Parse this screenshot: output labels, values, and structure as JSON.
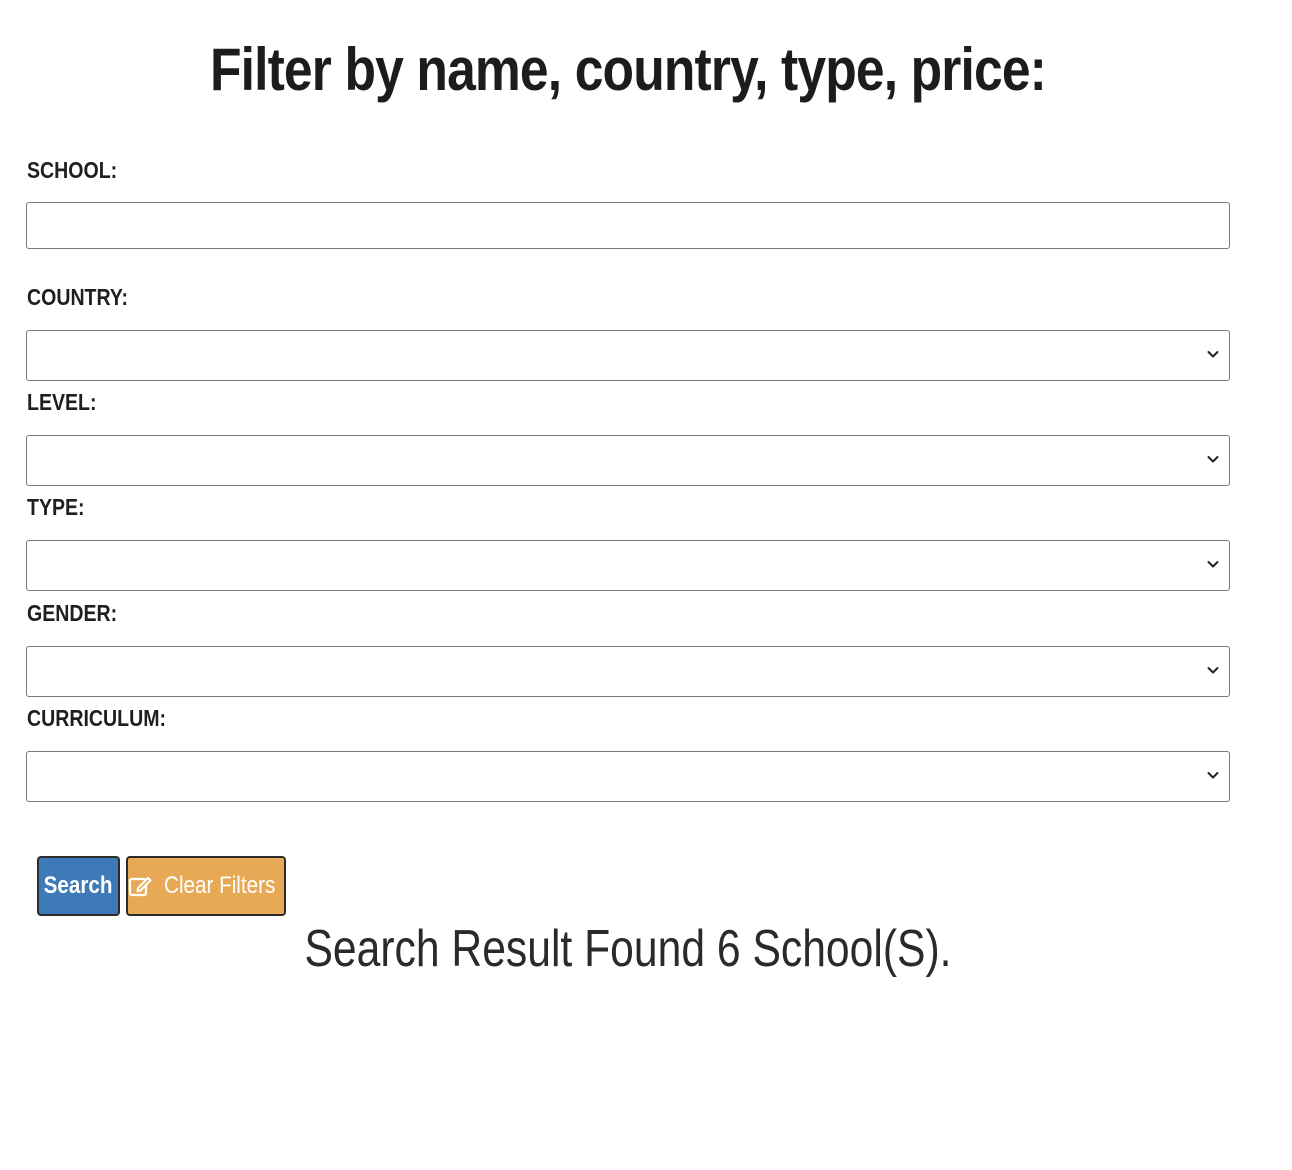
{
  "header": {
    "title": "Filter by name, country, type, price:"
  },
  "form": {
    "school": {
      "label": "SCHOOL:",
      "value": "",
      "placeholder": ""
    },
    "country": {
      "label": "COUNTRY:",
      "selected": ""
    },
    "level": {
      "label": "LEVEL:",
      "selected": ""
    },
    "type": {
      "label": "TYPE:",
      "selected": ""
    },
    "gender": {
      "label": "GENDER:",
      "selected": ""
    },
    "curriculum": {
      "label": "CURRICULUM:",
      "selected": ""
    }
  },
  "buttons": {
    "search_label": "Search",
    "clear_label": "Clear Filters",
    "clear_icon": "edit-icon"
  },
  "result": {
    "text": "Search Result Found 6 School(S)."
  },
  "colors": {
    "search_button": "#3f7ab8",
    "clear_button": "#e7a955"
  }
}
